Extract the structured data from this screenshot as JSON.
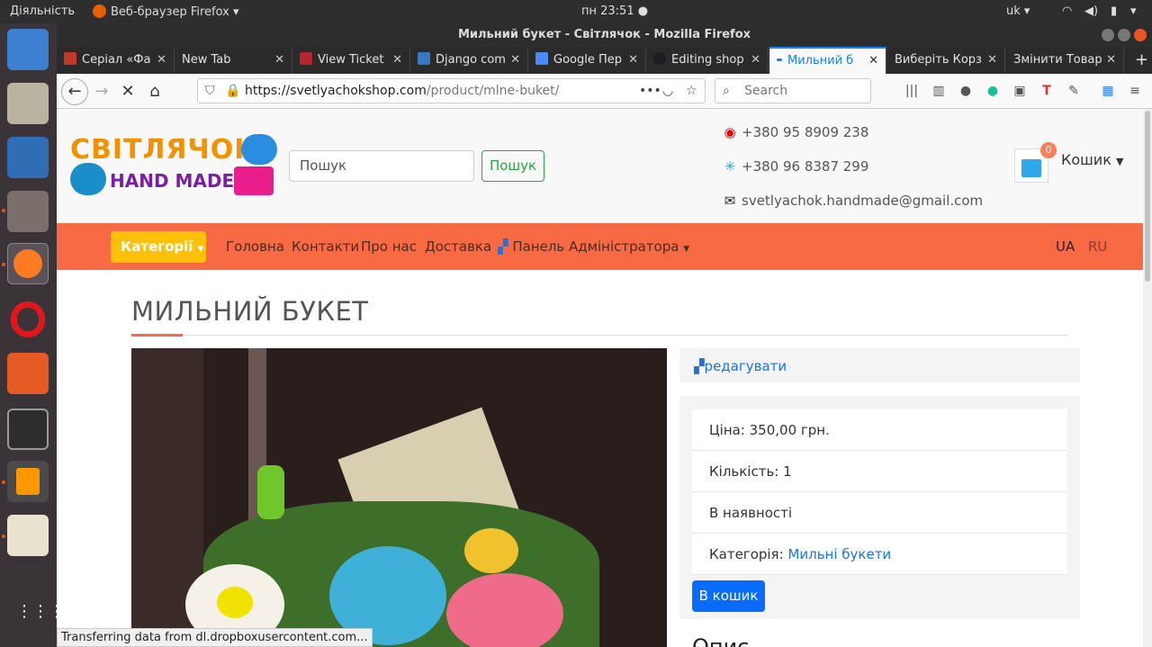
{
  "top_bar": {
    "activities": "Діяльність",
    "app_menu": "Веб-браузер Firefox",
    "clock": "пн 23:51",
    "lang": "uk"
  },
  "window": {
    "title": "Мильний букет - Світлячок - Mozilla Firefox"
  },
  "tabs": [
    {
      "label": "Серіал «Фа",
      "fav_color": "#c0392b"
    },
    {
      "label": "New Tab",
      "fav_color": ""
    },
    {
      "label": "View Ticket",
      "fav_color": "#b3262e"
    },
    {
      "label": "Django com",
      "fav_color": "#3b78c4"
    },
    {
      "label": "Google Пер",
      "fav_color": "#4c8bf5"
    },
    {
      "label": "Editing shop",
      "fav_color": "#1b1f23"
    },
    {
      "label": "Мильний б",
      "fav_color": "#0a84ff"
    },
    {
      "label": "Виберіть Корз",
      "fav_color": ""
    },
    {
      "label": "Змінити Товар",
      "fav_color": ""
    }
  ],
  "address": {
    "host": "https://svetlyachokshop.com",
    "path": "/product/mlne-buket/",
    "search_placeholder": "Search"
  },
  "site": {
    "logo_top": "СВІТЛЯЧОК",
    "logo_bottom": "HAND MADE",
    "search_placeholder": "Пошук",
    "search_button": "Пошук",
    "phone1": "+380 95 8909 238",
    "phone2": "+380 96 8387 299",
    "email": "svetlyachok.handmade@gmail.com",
    "cart_count": "0",
    "cart_label": "Кошик",
    "menu": {
      "categories": "Категорії",
      "home": "Головна",
      "contacts": "Контакти",
      "about": "Про нас",
      "delivery": "Доставка",
      "admin": "Панель Адміністратора",
      "lang_ua": "UA",
      "lang_ru": "RU"
    }
  },
  "product": {
    "title": "МИЛЬНИЙ БУКЕТ",
    "edit_link": "редагувати",
    "price": "Ціна: 350,00 грн.",
    "quantity": "Кількість: 1",
    "availability": "В наявності",
    "category_label": "Категорія:",
    "category_link": "Мильні букети",
    "buy_button": "В кошик",
    "description_heading": "Опис"
  },
  "status_bar": "Transferring data from dl.dropboxusercontent.com..."
}
